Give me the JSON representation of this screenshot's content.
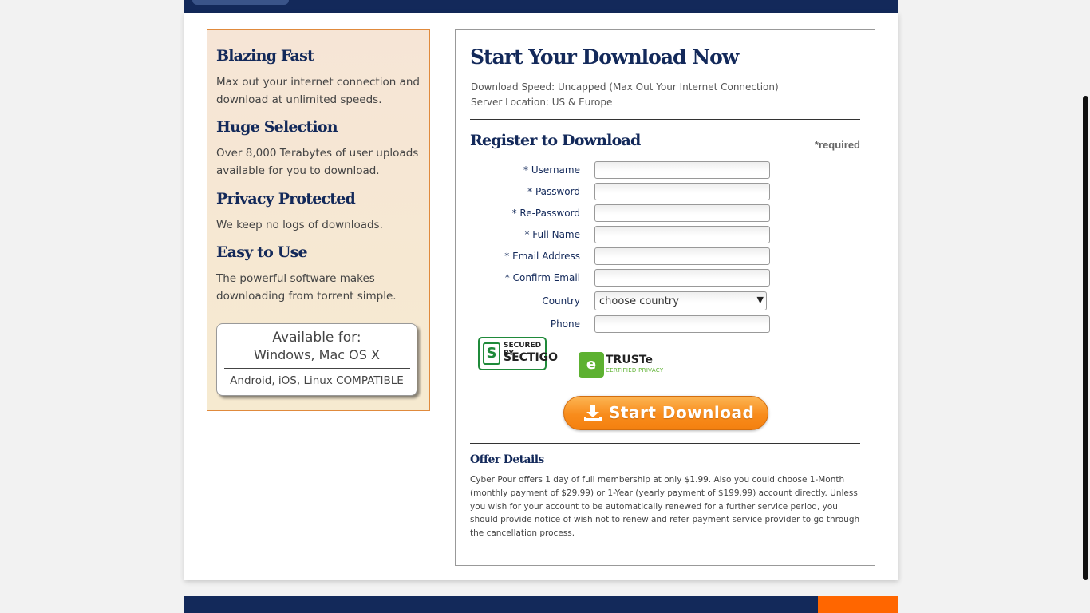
{
  "features": [
    {
      "title": "Blazing Fast",
      "text": "Max out your internet connection and download at unlimited speeds."
    },
    {
      "title": "Huge Selection",
      "text": "Over 8,000 Terabytes of user uploads available for you to download."
    },
    {
      "title": "Privacy Protected",
      "text": "We keep no logs of downloads."
    },
    {
      "title": "Easy to Use",
      "text": "The powerful software makes downloading from torrent simple."
    }
  ],
  "availability": {
    "label": "Available for:",
    "platforms": "Windows, Mac OS X",
    "compatible": "Android, iOS, Linux COMPATIBLE"
  },
  "download_box": {
    "title": "Start Your Download Now",
    "speed": "Download Speed: Uncapped (Max Out Your Internet Connection)",
    "server": "Server Location: US & Europe"
  },
  "register": {
    "title": "Register to Download",
    "required_note": "*required",
    "fields": [
      {
        "label": "* Username",
        "value": ""
      },
      {
        "label": "* Password",
        "value": ""
      },
      {
        "label": "* Re-Password",
        "value": ""
      },
      {
        "label": "* Full Name",
        "value": ""
      },
      {
        "label": "* Email Address",
        "value": ""
      },
      {
        "label": "* Confirm Email",
        "value": ""
      },
      {
        "label": "Phone",
        "value": ""
      }
    ],
    "country": {
      "label": "Country",
      "value": "choose country"
    }
  },
  "badges": {
    "sectigo_line1": "SECURED BY",
    "sectigo_line2": "SECTIGO",
    "truste_line1": "TRUSTe",
    "truste_line2": "CERTIFIED PRIVACY"
  },
  "download_button": {
    "label": "Start Download"
  },
  "offer": {
    "title": "Offer Details",
    "text": "Cyber Pour offers 1 day of full membership at only $1.99. Also you could choose 1-Month (monthly payment of $29.99) or 1-Year (yearly payment of $199.99) account directly. Unless you wish for your account to be automatically renewed for a further service period, you should provide notice of wish not to renew and refer payment service provider to go through the cancellation process."
  },
  "colors": {
    "navy": "#13295a",
    "orange": "#f88c1c",
    "feature_border": "#e08a3c"
  }
}
